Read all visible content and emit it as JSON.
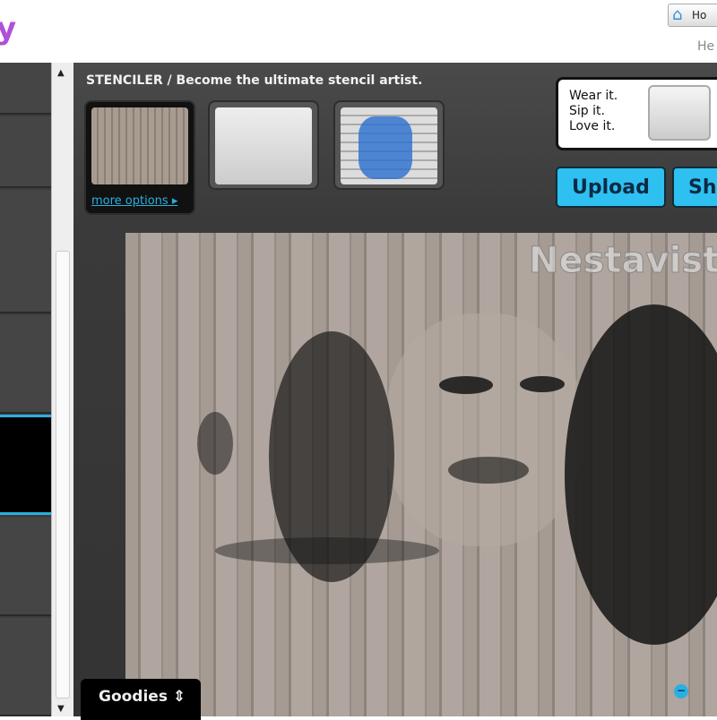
{
  "header": {
    "logo_fragment": "y",
    "home_label": "Ho",
    "help_label": "He"
  },
  "app": {
    "title": "STENCILER / Become the ultimate stencil artist.",
    "more_options": "more options ▸"
  },
  "promo": {
    "lines": [
      "Wear it.",
      "Sip it.",
      "Love it."
    ]
  },
  "buttons": {
    "upload": "Upload",
    "share": "Sha"
  },
  "canvas": {
    "watermark": "Nestavista"
  },
  "goodies": {
    "label": "Goodies ⇕"
  },
  "icons": {
    "zoom_out": "−",
    "scroll_up": "▲",
    "scroll_down": "▼",
    "home": "⌂"
  }
}
